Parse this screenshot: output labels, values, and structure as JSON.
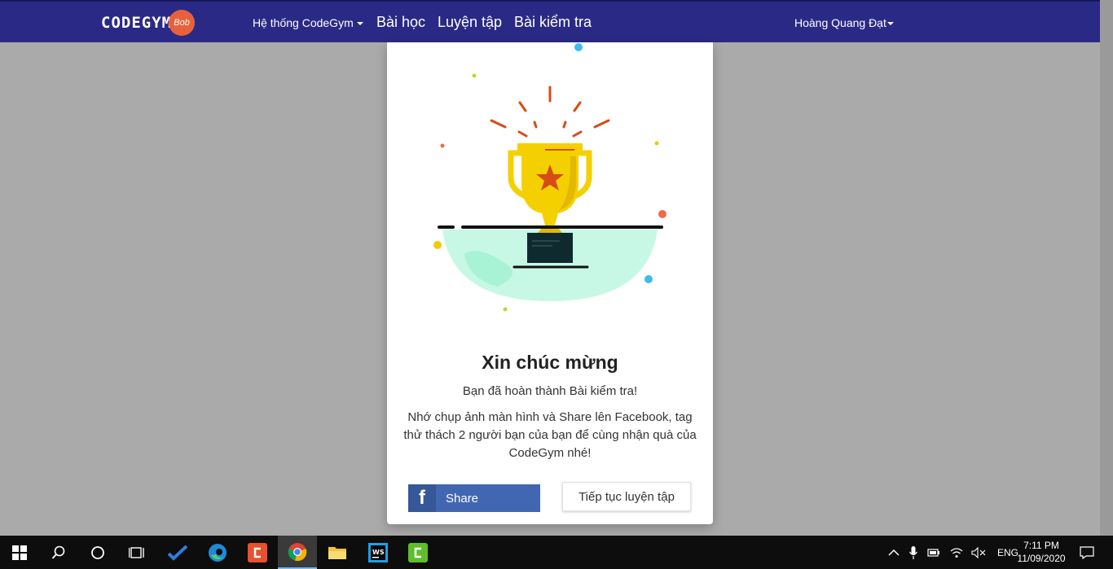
{
  "navbar": {
    "logo_text": "CODEGYM",
    "logo_badge": "Bob",
    "items": [
      {
        "label": "Hệ thống CodeGym",
        "dropdown": true
      },
      {
        "label": "Bài học"
      },
      {
        "label": "Luyện tập"
      },
      {
        "label": "Bài kiểm tra"
      }
    ],
    "user": {
      "label": "Hoàng Quang Đạt",
      "dropdown": true
    },
    "background": "#2a2a86"
  },
  "modal": {
    "title": "Xin chúc mừng",
    "subtitle": "Bạn đã hoàn thành Bài kiểm tra!",
    "description": "Nhớ chụp ảnh màn hình và Share lên Facebook, tag thử thách 2 người bạn của bạn để cùng nhận quà của CodeGym nhé!",
    "share_button": {
      "icon": "facebook-icon",
      "label": "Share"
    },
    "continue_button": {
      "label": "Tiếp tục luyện tập"
    }
  },
  "taskbar": {
    "icons": [
      "windows-start-icon",
      "search-icon",
      "cortana-icon",
      "task-view-icon",
      "todo-icon",
      "edge-icon",
      "codegym-app-icon",
      "chrome-icon",
      "file-explorer-icon",
      "webstorm-icon",
      "camtasia-icon"
    ],
    "active_icon": "chrome-icon",
    "language": "ENG",
    "time": "7:11 PM",
    "date": "11/09/2020"
  }
}
